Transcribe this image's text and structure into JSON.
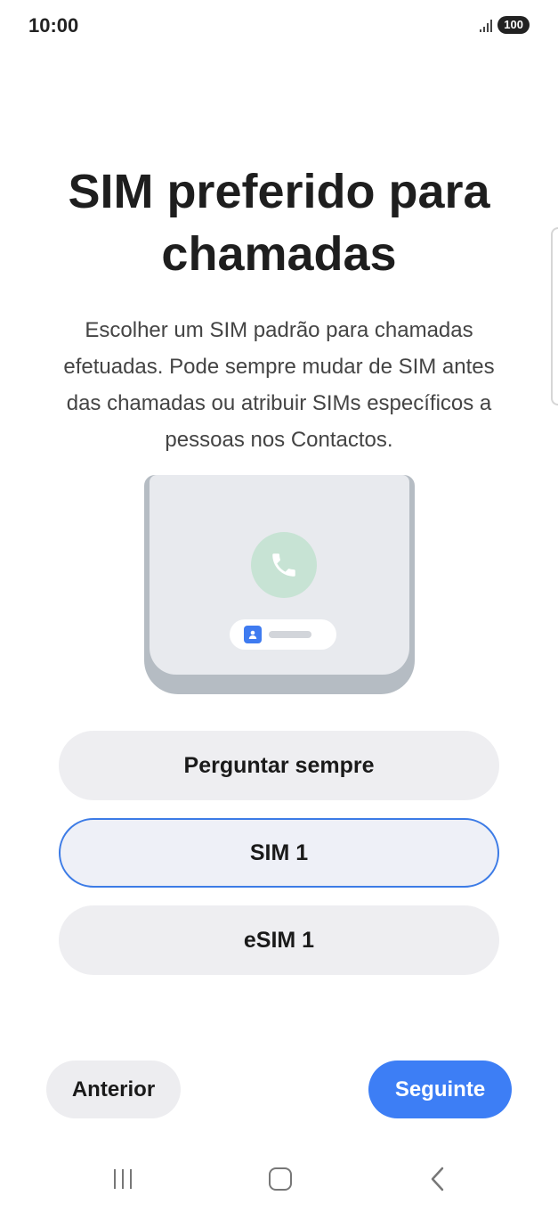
{
  "status_bar": {
    "time": "10:00",
    "battery": "100"
  },
  "page": {
    "title": "SIM preferido para chamadas",
    "description": "Escolher um SIM padrão para chamadas efetuadas. Pode sempre mudar de SIM antes das chamadas ou atribuir SIMs específicos a pessoas nos Contactos."
  },
  "options": [
    {
      "label": "Perguntar sempre",
      "selected": false
    },
    {
      "label": "SIM 1",
      "selected": true
    },
    {
      "label": "eSIM 1",
      "selected": false
    }
  ],
  "buttons": {
    "previous": "Anterior",
    "next": "Seguinte"
  },
  "colors": {
    "accent": "#3d7ef5",
    "call_circle": "#c7e3d4",
    "selected_border": "#3c7be6"
  },
  "icons": [
    "signal-icon",
    "phone-icon",
    "contact-icon",
    "recents-icon",
    "home-icon",
    "back-icon"
  ]
}
